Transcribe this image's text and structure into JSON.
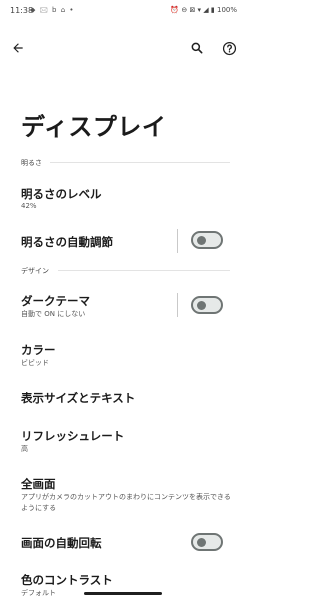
{
  "status_bar": {
    "time": "11:38",
    "notification_icons": "◆ 🖂 b ⌂ •",
    "system_icons": "⏰ ⊖ ⊠ ▾ ◢ ▮",
    "battery": "100%"
  },
  "top_bar": {
    "back_icon": "arrow-left-icon",
    "search_icon": "search-icon",
    "help_icon": "help-icon"
  },
  "page_title": "ディスプレイ",
  "sections": {
    "brightness_header": "明るさ",
    "design_header": "デザイン"
  },
  "rows": {
    "brightness_level": {
      "title": "明るさのレベル",
      "subtitle": "42%"
    },
    "adaptive_brightness": {
      "title": "明るさの自動調節",
      "toggle_on": false
    },
    "dark_theme": {
      "title": "ダークテーマ",
      "subtitle": "自動で ON にしない",
      "toggle_on": false
    },
    "colors": {
      "title": "カラー",
      "subtitle": "ビビッド"
    },
    "display_size": {
      "title": "表示サイズとテキスト"
    },
    "refresh_rate": {
      "title": "リフレッシュレート",
      "subtitle": "高"
    },
    "fullscreen": {
      "title": "全画面",
      "subtitle": "アプリがカメラのカットアウトのまわりにコンテンツを表示できるようにする"
    },
    "auto_rotate": {
      "title": "画面の自動回転",
      "toggle_on": false
    },
    "color_contrast": {
      "title": "色のコントラスト",
      "subtitle": "デフォルト"
    }
  }
}
